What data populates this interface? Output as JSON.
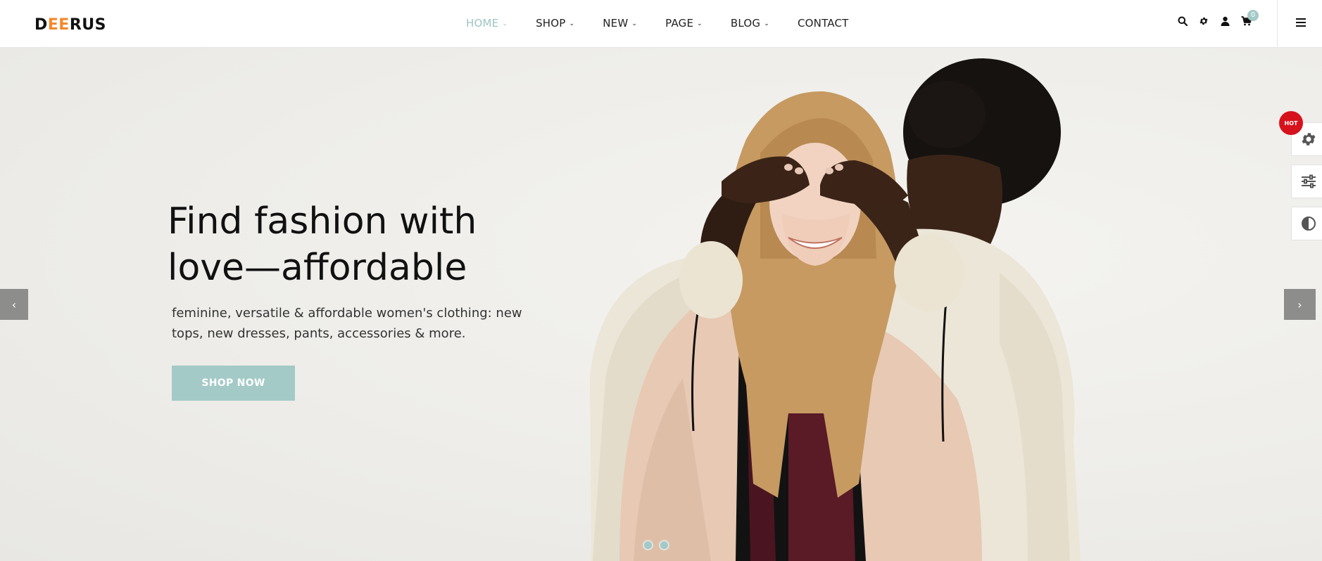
{
  "header": {
    "logo": {
      "part1": "D",
      "accent": "EE",
      "part2": "RUS"
    },
    "nav": [
      {
        "label": "HOME",
        "has_dropdown": true,
        "active": true
      },
      {
        "label": "SHOP",
        "has_dropdown": true,
        "active": false
      },
      {
        "label": "NEW",
        "has_dropdown": true,
        "active": false
      },
      {
        "label": "PAGE",
        "has_dropdown": true,
        "active": false
      },
      {
        "label": "BLOG",
        "has_dropdown": true,
        "active": false
      },
      {
        "label": "CONTACT",
        "has_dropdown": false,
        "active": false
      }
    ],
    "tools": [
      "search-icon",
      "gear-icon",
      "user-icon",
      "cart-icon"
    ],
    "cart_count": "0",
    "menu_icon": "hamburger-icon"
  },
  "hero": {
    "title_line1": "Find fashion with",
    "title_line2": "love—affordable",
    "subtitle_line1": "feminine, versatile & affordable women's clothing: new",
    "subtitle_line2": "tops, new dresses, pants, accessories & more.",
    "cta_label": "SHOP NOW",
    "prev_arrow": "‹",
    "next_arrow": "›",
    "slide_count": 2
  },
  "side_panel": {
    "badge": "HOT",
    "buttons": [
      "gear-icon",
      "sliders-icon",
      "contrast-icon"
    ]
  },
  "colors": {
    "accent": "#a3cac7",
    "logo_accent": "#f28a2c",
    "hot_badge": "#d6121c",
    "arrow_bg": "#8d8d8b"
  }
}
